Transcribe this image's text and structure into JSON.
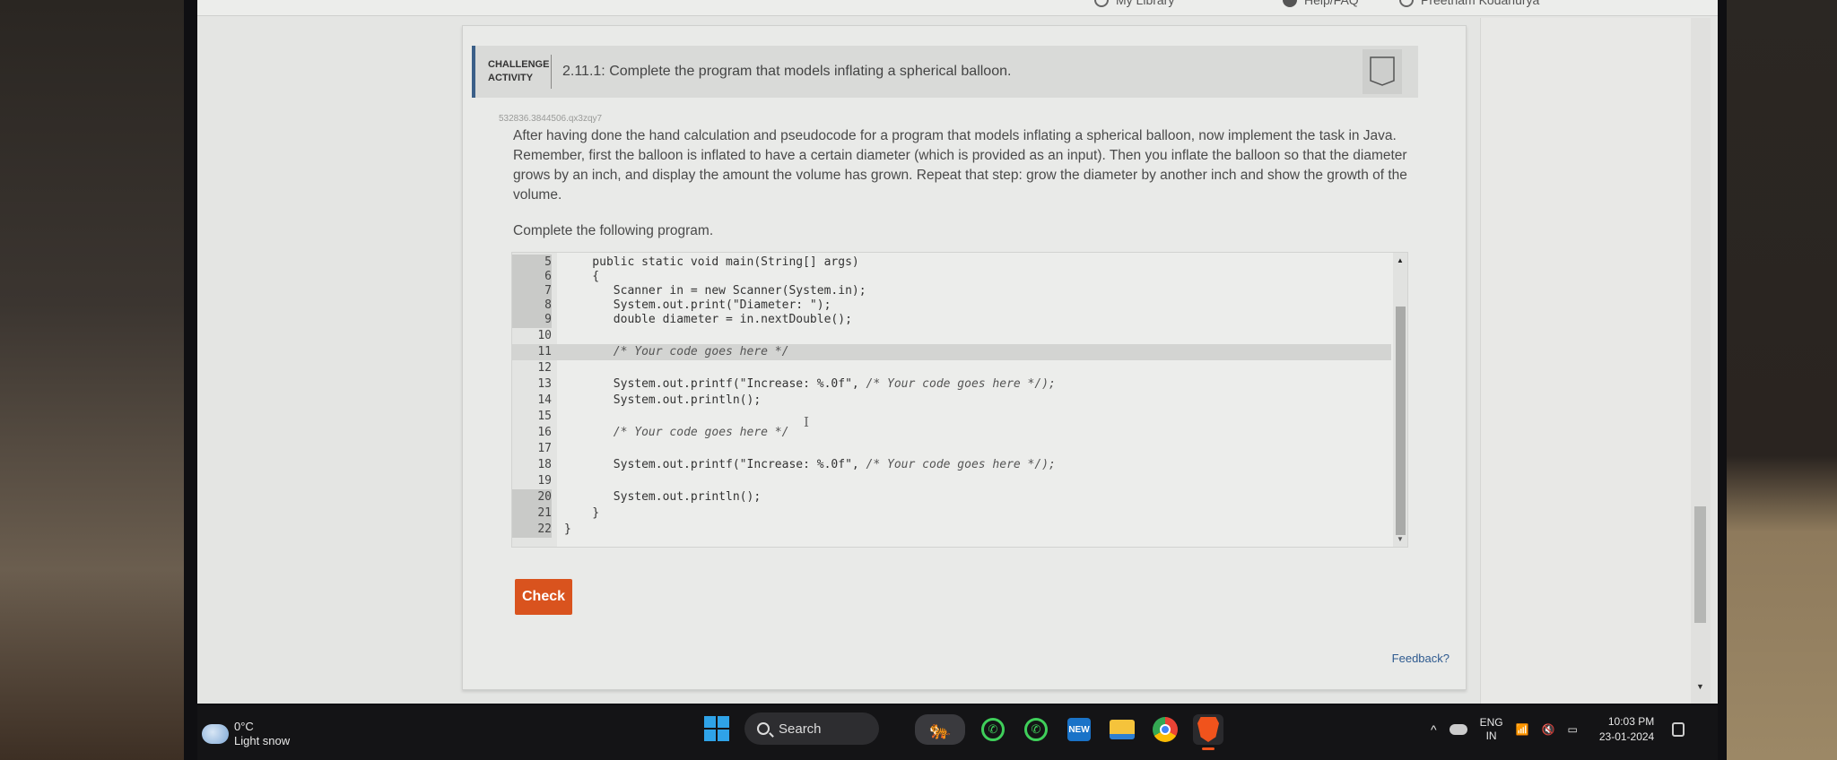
{
  "browser_nav": {
    "items": [
      {
        "label": "My Library",
        "icon": "library-icon"
      },
      {
        "label": "Help/FAQ",
        "icon": "help-icon"
      },
      {
        "label": "Preetham Kodanurya",
        "icon": "user-icon"
      }
    ]
  },
  "activity": {
    "tag_line1": "CHALLENGE",
    "tag_line2": "ACTIVITY",
    "title": "2.11.1: Complete the program that models inflating a spherical balloon.",
    "id": "532836.3844506.qx3zqy7",
    "prompt": "After having done the hand calculation and pseudocode for a program that models inflating a spherical balloon, now implement the task in Java. Remember, first the balloon is inflated to have a certain diameter (which is provided as an input). Then you inflate the balloon so that the diameter grows by an inch, and display the amount the volume has grown. Repeat that step: grow the diameter by another inch and show the growth of the volume.",
    "complete_label": "Complete the following program."
  },
  "editor": {
    "lines": [
      {
        "num": "5",
        "text": "    public static void main(String[] args)",
        "comment": ""
      },
      {
        "num": "6",
        "text": "    {",
        "comment": ""
      },
      {
        "num": "7",
        "text": "       Scanner in = new Scanner(System.in);",
        "comment": ""
      },
      {
        "num": "8",
        "text": "       System.out.print(\"Diameter: \");",
        "comment": ""
      },
      {
        "num": "9",
        "text": "       double diameter = in.nextDouble();",
        "comment": ""
      },
      {
        "num": "10",
        "text": "",
        "comment": ""
      },
      {
        "num": "11",
        "text": "       ",
        "comment": "/* Your code goes here */"
      },
      {
        "num": "12",
        "text": "",
        "comment": ""
      },
      {
        "num": "13",
        "text": "       System.out.printf(\"Increase: %.0f\", ",
        "comment": "/* Your code goes here */);"
      },
      {
        "num": "14",
        "text": "       System.out.println();",
        "comment": ""
      },
      {
        "num": "15",
        "text": "",
        "comment": ""
      },
      {
        "num": "16",
        "text": "       ",
        "comment": "/* Your code goes here */"
      },
      {
        "num": "17",
        "text": "",
        "comment": ""
      },
      {
        "num": "18",
        "text": "       System.out.printf(\"Increase: %.0f\", ",
        "comment": "/* Your code goes here */);"
      },
      {
        "num": "19",
        "text": "",
        "comment": ""
      },
      {
        "num": "20",
        "text": "       System.out.println();",
        "comment": ""
      },
      {
        "num": "21",
        "text": "    }",
        "comment": ""
      },
      {
        "num": "22",
        "text": "}",
        "comment": ""
      }
    ],
    "active_line": "11"
  },
  "buttons": {
    "check": "Check",
    "feedback": "Feedback?"
  },
  "taskbar": {
    "weather_temp": "0°C",
    "weather_desc": "Light snow",
    "search_label": "Search",
    "outlook_badge": "NEW",
    "lang_line1": "ENG",
    "lang_line2": "IN",
    "time": "10:03 PM",
    "date": "23-01-2024"
  },
  "colors": {
    "check_button": "#d9531e",
    "feedback_link": "#2e5a8f",
    "activity_accent": "#3b5f88"
  }
}
